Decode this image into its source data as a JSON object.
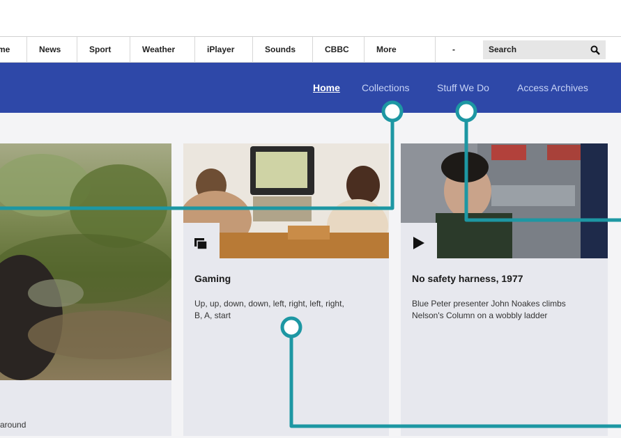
{
  "nav": {
    "items": [
      "me",
      "News",
      "Sport",
      "Weather",
      "iPlayer",
      "Sounds",
      "CBBC",
      "More"
    ],
    "dropdown": "-",
    "search_label": "Search"
  },
  "subnav": {
    "links": [
      "Home",
      "Collections",
      "Stuff We Do",
      "Access Archives"
    ],
    "active": "Home"
  },
  "cards": [
    {
      "title": "",
      "desc": "around"
    },
    {
      "title": "Gaming",
      "desc_lines": [
        "Up, up, down, down, left, right, left, right,",
        "B, A, start"
      ]
    },
    {
      "title": "No safety harness, 1977",
      "desc_lines": [
        "Blue Peter presenter John Noakes climbs",
        "Nelson's Column on a wobbly ladder"
      ]
    }
  ],
  "colors": {
    "brand_blue": "#2e48a8",
    "callout_teal": "#1d97a3"
  }
}
